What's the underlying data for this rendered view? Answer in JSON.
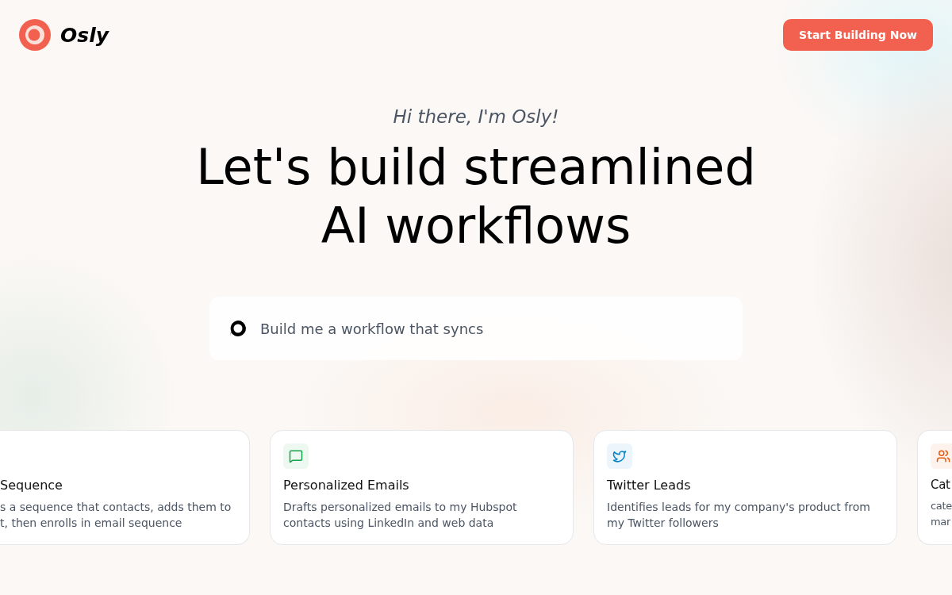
{
  "brand": {
    "name": "Osly"
  },
  "cta": {
    "label": "Start Building Now"
  },
  "hero": {
    "greeting": "Hi there, I'm Osly!",
    "headline_lines": [
      "Let's build streamlined",
      "AI workflows"
    ]
  },
  "prompt": {
    "value": "Build me a workflow that syncs"
  },
  "cards": [
    {
      "kind": "plain",
      "title": "Sequence",
      "lines": [
        "s a sequence that contacts, adds them to",
        "t, then enrolls in email sequence"
      ]
    },
    {
      "kind": "chat",
      "color": "#16a34a",
      "title": "Personalized Emails",
      "lines": [
        "Drafts personalized emails to my Hubspot",
        "contacts using LinkedIn and web data"
      ]
    },
    {
      "kind": "bird",
      "color": "#0284c7",
      "title": "Twitter Leads",
      "lines": [
        "Identifies leads for my company's product from",
        "my Twitter followers"
      ]
    },
    {
      "kind": "people",
      "color": "#ea580c",
      "title": "Cat",
      "lines": [
        "cate",
        "mar"
      ]
    }
  ]
}
